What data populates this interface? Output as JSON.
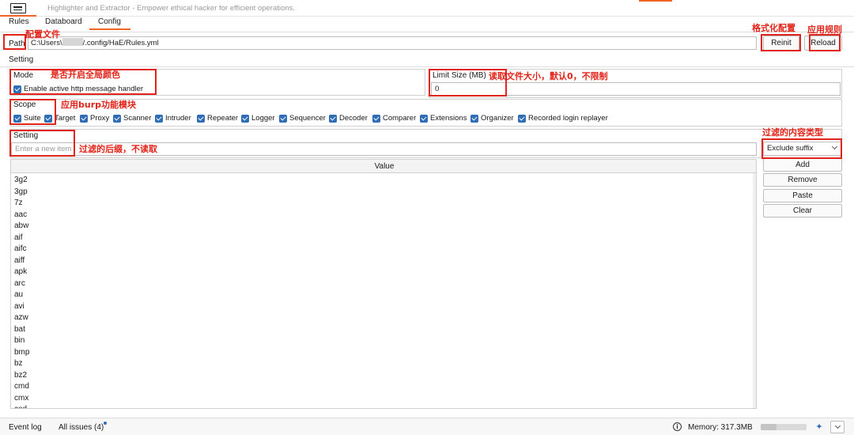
{
  "app": {
    "title": "Highlighter and Extractor - Empower ethical hacker for efficient operations."
  },
  "tabs": [
    {
      "label": "Rules"
    },
    {
      "label": "Databoard"
    },
    {
      "label": "Config"
    }
  ],
  "path": {
    "label": "Path",
    "value_prefix": "C:\\Users\\",
    "value_suffix": "/.config/HaE/Rules.yml"
  },
  "buttons": {
    "reinit": "Reinit",
    "reload": "Reload"
  },
  "setting_section": "Setting",
  "mode": {
    "title": "Mode",
    "checkbox_label": "Enable active http message handler",
    "checked": true
  },
  "limit_size": {
    "title": "Limit Size (MB)",
    "value": "0"
  },
  "scope": {
    "title": "Scope",
    "items": [
      {
        "label": "Suite",
        "checked": true
      },
      {
        "label": "Target",
        "checked": true
      },
      {
        "label": "Proxy",
        "checked": true
      },
      {
        "label": "Scanner",
        "checked": true
      },
      {
        "label": "Intruder",
        "checked": true
      },
      {
        "label": "Repeater",
        "checked": true
      },
      {
        "label": "Logger",
        "checked": true
      },
      {
        "label": "Sequencer",
        "checked": true
      },
      {
        "label": "Decoder",
        "checked": true
      },
      {
        "label": "Comparer",
        "checked": true
      },
      {
        "label": "Extensions",
        "checked": true
      },
      {
        "label": "Organizer",
        "checked": true
      },
      {
        "label": "Recorded login replayer",
        "checked": true
      }
    ]
  },
  "filter_setting": {
    "title": "Setting",
    "new_item_placeholder": "Enter a new item",
    "type_selected": "Exclude suffix",
    "column_header": "Value",
    "values": [
      "3g2",
      "3gp",
      "7z",
      "aac",
      "abw",
      "aif",
      "aifc",
      "aiff",
      "apk",
      "arc",
      "au",
      "avi",
      "azw",
      "bat",
      "bin",
      "bmp",
      "bz",
      "bz2",
      "cmd",
      "cmx",
      "cod"
    ],
    "side_buttons": [
      "Add",
      "Remove",
      "Paste",
      "Clear"
    ]
  },
  "annotations": {
    "path": "配置文件",
    "reinit": "格式化配置",
    "reload": "应用规则",
    "mode": "是否开启全局颜色",
    "limit": "读取文件大小，默认0，不限制",
    "scope": "应用burp功能模块",
    "suffix": "过滤的后缀，不读取",
    "type": "过滤的内容类型"
  },
  "status": {
    "event_log": "Event log",
    "all_issues": "All issues (4)",
    "memory": "Memory: 317.3MB",
    "memory_fraction": 0.35
  },
  "colors": {
    "accent": "#f26422",
    "annotation": "#e1251b",
    "checkbox": "#2f6db5"
  }
}
